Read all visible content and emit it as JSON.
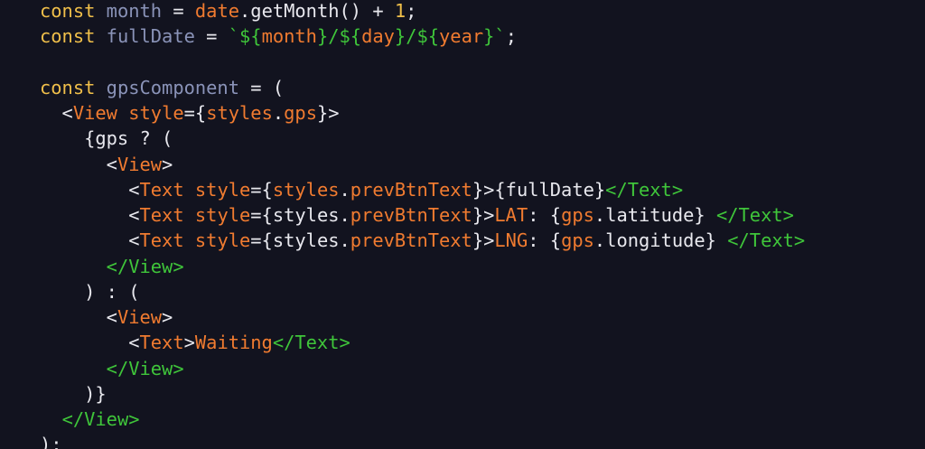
{
  "editor": {
    "lines": [
      [
        {
          "t": "const",
          "c": "kw"
        },
        {
          "t": " ",
          "c": "plain"
        },
        {
          "t": "month",
          "c": "var"
        },
        {
          "t": " = ",
          "c": "plain"
        },
        {
          "t": "date",
          "c": "obj"
        },
        {
          "t": ".getMonth() + ",
          "c": "plain"
        },
        {
          "t": "1",
          "c": "num"
        },
        {
          "t": ";",
          "c": "plain"
        }
      ],
      [
        {
          "t": "const",
          "c": "kw"
        },
        {
          "t": " ",
          "c": "plain"
        },
        {
          "t": "fullDate",
          "c": "var"
        },
        {
          "t": " = ",
          "c": "plain"
        },
        {
          "t": "`${",
          "c": "str"
        },
        {
          "t": "month",
          "c": "tmpl"
        },
        {
          "t": "}/${",
          "c": "str"
        },
        {
          "t": "day",
          "c": "tmpl"
        },
        {
          "t": "}/${",
          "c": "str"
        },
        {
          "t": "year",
          "c": "tmpl"
        },
        {
          "t": "}`",
          "c": "str"
        },
        {
          "t": ";",
          "c": "plain"
        }
      ],
      [],
      [
        {
          "t": "const",
          "c": "kw"
        },
        {
          "t": " ",
          "c": "plain"
        },
        {
          "t": "gpsComponent",
          "c": "var"
        },
        {
          "t": " = (",
          "c": "plain"
        }
      ],
      [
        {
          "t": "  <",
          "c": "plain"
        },
        {
          "t": "View",
          "c": "tag"
        },
        {
          "t": " ",
          "c": "plain"
        },
        {
          "t": "style",
          "c": "attr"
        },
        {
          "t": "={",
          "c": "plain"
        },
        {
          "t": "styles",
          "c": "obj"
        },
        {
          "t": ".",
          "c": "plain"
        },
        {
          "t": "gps",
          "c": "obj"
        },
        {
          "t": "}>",
          "c": "plain"
        }
      ],
      [
        {
          "t": "    {gps ? (",
          "c": "plain"
        }
      ],
      [
        {
          "t": "      <",
          "c": "plain"
        },
        {
          "t": "View",
          "c": "tag"
        },
        {
          "t": ">",
          "c": "plain"
        }
      ],
      [
        {
          "t": "        <",
          "c": "plain"
        },
        {
          "t": "Text",
          "c": "tag"
        },
        {
          "t": " ",
          "c": "plain"
        },
        {
          "t": "style",
          "c": "attr"
        },
        {
          "t": "={",
          "c": "plain"
        },
        {
          "t": "styles",
          "c": "obj"
        },
        {
          "t": ".",
          "c": "plain"
        },
        {
          "t": "prevBtnText",
          "c": "obj"
        },
        {
          "t": "}>{fullDate}",
          "c": "plain"
        },
        {
          "t": "</Text>",
          "c": "close"
        }
      ],
      [
        {
          "t": "        <",
          "c": "plain"
        },
        {
          "t": "Text",
          "c": "tag"
        },
        {
          "t": " ",
          "c": "plain"
        },
        {
          "t": "style",
          "c": "attr"
        },
        {
          "t": "={styles.",
          "c": "plain"
        },
        {
          "t": "prevBtnText",
          "c": "obj"
        },
        {
          "t": "}>",
          "c": "plain"
        },
        {
          "t": "LAT",
          "c": "obj"
        },
        {
          "t": ": {",
          "c": "plain"
        },
        {
          "t": "gps",
          "c": "obj"
        },
        {
          "t": ".latitude} ",
          "c": "plain"
        },
        {
          "t": "</Text>",
          "c": "close"
        }
      ],
      [
        {
          "t": "        <",
          "c": "plain"
        },
        {
          "t": "Text",
          "c": "tag"
        },
        {
          "t": " ",
          "c": "plain"
        },
        {
          "t": "style",
          "c": "attr"
        },
        {
          "t": "={styles.",
          "c": "plain"
        },
        {
          "t": "prevBtnText",
          "c": "obj"
        },
        {
          "t": "}>",
          "c": "plain"
        },
        {
          "t": "LNG",
          "c": "obj"
        },
        {
          "t": ": {",
          "c": "plain"
        },
        {
          "t": "gps",
          "c": "obj"
        },
        {
          "t": ".longitude} ",
          "c": "plain"
        },
        {
          "t": "</Text>",
          "c": "close"
        }
      ],
      [
        {
          "t": "      ",
          "c": "plain"
        },
        {
          "t": "</View>",
          "c": "close"
        }
      ],
      [
        {
          "t": "    ) : (",
          "c": "plain"
        }
      ],
      [
        {
          "t": "      <",
          "c": "plain"
        },
        {
          "t": "View",
          "c": "tag"
        },
        {
          "t": ">",
          "c": "plain"
        }
      ],
      [
        {
          "t": "        <",
          "c": "plain"
        },
        {
          "t": "Text",
          "c": "tag"
        },
        {
          "t": ">",
          "c": "plain"
        },
        {
          "t": "Waiting",
          "c": "obj"
        },
        {
          "t": "</Text>",
          "c": "close"
        }
      ],
      [
        {
          "t": "      ",
          "c": "plain"
        },
        {
          "t": "</View>",
          "c": "close"
        }
      ],
      [
        {
          "t": "    )}",
          "c": "plain"
        }
      ],
      [
        {
          "t": "  ",
          "c": "plain"
        },
        {
          "t": "</View>",
          "c": "close"
        }
      ],
      [
        {
          "t": ");",
          "c": "plain"
        }
      ]
    ]
  }
}
